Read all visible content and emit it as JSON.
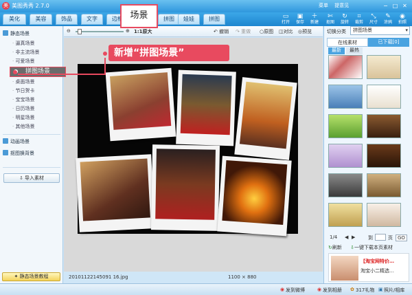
{
  "app": {
    "title": "美图秀秀 2.7.0",
    "top_links": [
      "菜单",
      "提意见"
    ]
  },
  "tabs": [
    "美化",
    "美容",
    "饰品",
    "文字",
    "边框",
    "拼图",
    "娃娃",
    "拼图"
  ],
  "active_tab_popup": "场景",
  "toolbar_right": [
    "打开",
    "保存",
    "新建",
    "抠图",
    "旋转",
    "裁剪",
    "尺寸",
    "涂鸦",
    "拍照"
  ],
  "sidebar": {
    "static_header": "静态场景",
    "items": [
      "逼真场景",
      "非主流场景",
      "可爱场景"
    ],
    "selected": "拼图场景",
    "items2": [
      "桌面场景",
      "节日贺卡",
      "宝宝场景",
      "日历场景",
      "明星场景",
      "其他场景"
    ],
    "dynamic_header": "动画场景",
    "cutout_header": "抠图换背景",
    "import_button": "导入素材",
    "tutorial_button": "静态场景教程"
  },
  "edit_toolbar": {
    "zoom_label": "1:1原大",
    "undo": "撤销",
    "redo": "重做",
    "original": "原图",
    "compare": "对比",
    "preview": "预览"
  },
  "callout": "新增“拼图场景”",
  "status": {
    "filename": "20101122145091 16.jpg",
    "dimensions": "1100 × 880"
  },
  "right_panel": {
    "category_label": "切换分类",
    "category_value": "拼图场景",
    "online_tab": "在线素材",
    "downloaded_tab": "已下载[0]",
    "subtabs": [
      "最新",
      "最热"
    ],
    "pager": {
      "page": "1/4",
      "goto": "到",
      "page_unit": "页",
      "go": "GO"
    },
    "refresh": "刷新",
    "download_all": "一键下载本页素材",
    "ad_title": "【淘宝网特价…",
    "ad_sub": "淘宝小二精选…"
  },
  "bottom_bar": {
    "share1": "发到微博",
    "share2": "发到相册",
    "gift": "317礼物",
    "photo": "照片/相库"
  },
  "colors": {
    "accent": "#e84a5f",
    "tab_blue": "#2e97dd",
    "stage_black": "#060606"
  }
}
